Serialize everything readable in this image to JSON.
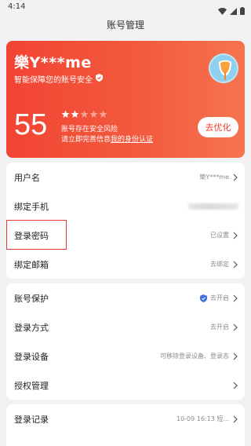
{
  "status_bar": {
    "time": "4:14"
  },
  "header": {
    "title": "账号管理"
  },
  "profile_card": {
    "username": "樂Y***me",
    "subtitle": "智能保障您的账号安全",
    "score": "55",
    "stars_filled": 2,
    "stars_total": 5,
    "risk_text": "账号存在安全风险",
    "prompt_text": "请立即完善信息",
    "identity_link": "我的身份认证",
    "optimize_button": "去优化",
    "colors": {
      "gradient_start": "#f24433",
      "gradient_end": "#f6744f"
    }
  },
  "group1": {
    "username": {
      "label": "用户名",
      "value": "樂Y***me"
    },
    "phone": {
      "label": "绑定手机"
    },
    "password": {
      "label": "登录密码",
      "value": "已设置"
    },
    "email": {
      "label": "绑定邮箱",
      "value": "去绑定"
    }
  },
  "group2": {
    "protection": {
      "label": "账号保护",
      "value": "去开启"
    },
    "login_method": {
      "label": "登录方式",
      "value": "去开启"
    },
    "devices": {
      "label": "登录设备",
      "value": "可移除登录设备、登录态"
    },
    "authorization": {
      "label": "授权管理"
    }
  },
  "group3": {
    "login_record": {
      "label": "登录记录",
      "value": "10-09 16:13 短..."
    },
    "next_label": "…"
  },
  "accent_colors": {
    "red": "#e53935",
    "shield_blue": "#3f6fe0"
  }
}
